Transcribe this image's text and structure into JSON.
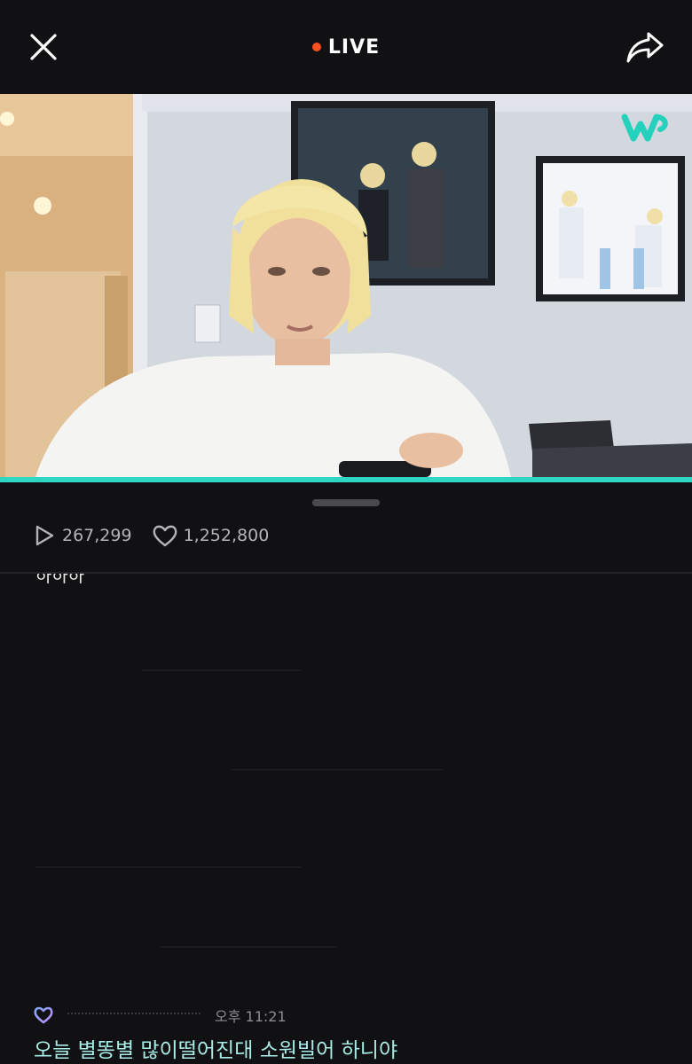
{
  "header": {
    "close_icon": "close-icon",
    "live_label": "LIVE",
    "share_icon": "share-icon",
    "live_dot_color": "#ff4f1f"
  },
  "video": {
    "watermark_icon": "weverse-logo-icon",
    "progress_color": "#2fd6c4"
  },
  "stats": {
    "plays": "267,299",
    "likes": "1,252,800",
    "plays_icon": "play-icon",
    "likes_icon": "heart-icon"
  },
  "chat": {
    "cut_off_line": "하하하",
    "latest_message": {
      "badge_icon": "membership-heart-icon",
      "time": "오후 11:21",
      "text": "오늘 별똥별 많이떨어진대 소원빌어 하니야",
      "text_color": "#a8ece7"
    }
  }
}
